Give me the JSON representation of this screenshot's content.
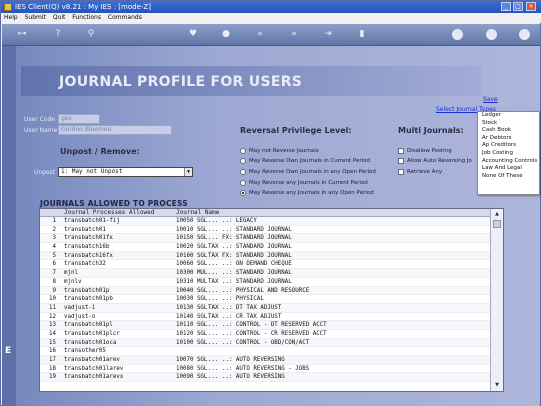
{
  "window": {
    "title": "IES Client(Q) v8.21 : My IES :      [mode-Z]",
    "controls": [
      "_",
      "□",
      "×"
    ]
  },
  "menu": [
    "Help",
    "Submit",
    "Quit",
    "Functions",
    "Commands"
  ],
  "toolbar": {
    "icons": [
      "key-icon",
      "help-icon",
      "search-icon",
      "heart-icon",
      "record-icon",
      "rewind-icon",
      "fast-forward-icon",
      "skip-icon",
      "page-icon",
      "plus-icon",
      "check-icon",
      "close-icon"
    ]
  },
  "page": {
    "title": "JOURNAL PROFILE FOR USERS",
    "save_link": "Save",
    "select_journal_types_link": "Select Journal Types"
  },
  "user": {
    "code_label": "User Code",
    "code_value": "ges",
    "name_label": "User Name",
    "name_value": "Gordon Bloemen"
  },
  "unpost": {
    "section_title": "Unpost / Remove:",
    "label": "Unpost",
    "selected": "1: May not Unpost"
  },
  "reversal": {
    "section_title": "Reversal Privilege Level:",
    "options": [
      {
        "label": "May not Reverse Journals",
        "selected": false
      },
      {
        "label": "May Reverse Own Journals in Current Period",
        "selected": false
      },
      {
        "label": "May Reverse Own Journals in any Open Period",
        "selected": false
      },
      {
        "label": "May Reverse any Journals in Current Period",
        "selected": false
      },
      {
        "label": "May Reverse any Journals in any Open Period",
        "selected": true
      }
    ]
  },
  "multi": {
    "section_title": "Multi Journals:",
    "options": [
      "Disallow Posting",
      "Allow Auto Reversing Jo",
      "Retrieve Any"
    ]
  },
  "journal_types_dropdown": [
    "Ledger",
    "Stock",
    "Cash Book",
    "Ar Debtors",
    "Ap Creditors",
    "Job Costing",
    "Accounting Controls",
    "Law And Legal",
    "None Of These"
  ],
  "grid": {
    "title": "JOURNALS ALLOWED TO PROCESS",
    "columns": [
      "Journal Processes Allowed",
      "Journal Name"
    ],
    "rows": [
      {
        "n": "1",
        "name": "transbatch01-fij",
        "code": "10050 SGL",
        "desc": "... ..: LEGACY"
      },
      {
        "n": "2",
        "name": "transbatch01",
        "code": "10010 SGL",
        "desc": "... ..: STANDARD JOURNAL"
      },
      {
        "n": "3",
        "name": "transbatch01fx",
        "code": "10150 SGL",
        "desc": "... FX: STANDARD JOURNAL"
      },
      {
        "n": "4",
        "name": "transbatch16b",
        "code": "10020 SGL",
        "desc": "TAX ..: STANDARD JOURNAL"
      },
      {
        "n": "5",
        "name": "transbatch16fx",
        "code": "10160 SGL",
        "desc": "TAX FX: STANDARD JOURNAL"
      },
      {
        "n": "6",
        "name": "transbatch32",
        "code": "10060 SGL",
        "desc": "... ..: ON DEMAND CHEQUE"
      },
      {
        "n": "7",
        "name": "mjnl",
        "code": "10300 MUL",
        "desc": "... ..: STANDARD JOURNAL"
      },
      {
        "n": "8",
        "name": "mjnlv",
        "code": "10310 MUL",
        "desc": "TAX ..: STANDARD JOURNAL"
      },
      {
        "n": "9",
        "name": "transbatch01p",
        "code": "10040 SGL",
        "desc": "... ..: PHYSICAL AND RESOURCE"
      },
      {
        "n": "10",
        "name": "transbatch01pb",
        "code": "10030 SGL",
        "desc": "... ..: PHYSICAL"
      },
      {
        "n": "11",
        "name": "vadjust-i",
        "code": "10130 SGL",
        "desc": "TAX ..: DT TAX ADJUST"
      },
      {
        "n": "12",
        "name": "vadjust-o",
        "code": "10140 SGL",
        "desc": "TAX ..: CR TAX ADJUST"
      },
      {
        "n": "13",
        "name": "transbatch01pl",
        "code": "10110 SGL",
        "desc": "... ..: CONTROL - DT RESERVED ACCT"
      },
      {
        "n": "14",
        "name": "transbatch01plcr",
        "code": "10120 SGL",
        "desc": "... ..: CONTROL - CR RESERVED ACCT"
      },
      {
        "n": "15",
        "name": "transbatch01oca",
        "code": "10100 SGL",
        "desc": "... ..: CONTROL - OBD/CON/ACT"
      },
      {
        "n": "16",
        "name": "transother05",
        "code": "",
        "desc": ""
      },
      {
        "n": "17",
        "name": "transbatch01arev",
        "code": "10070 SGL",
        "desc": "... ..: AUTO REVERSING"
      },
      {
        "n": "18",
        "name": "transbatch01larev",
        "code": "10080 SGL",
        "desc": "... ..: AUTO REVERSING - JOBS"
      },
      {
        "n": "19",
        "name": "transbatch01arevx",
        "code": "10090 SGL",
        "desc": "... ..: AUTO REVERSING"
      }
    ]
  },
  "side_marker": "E"
}
